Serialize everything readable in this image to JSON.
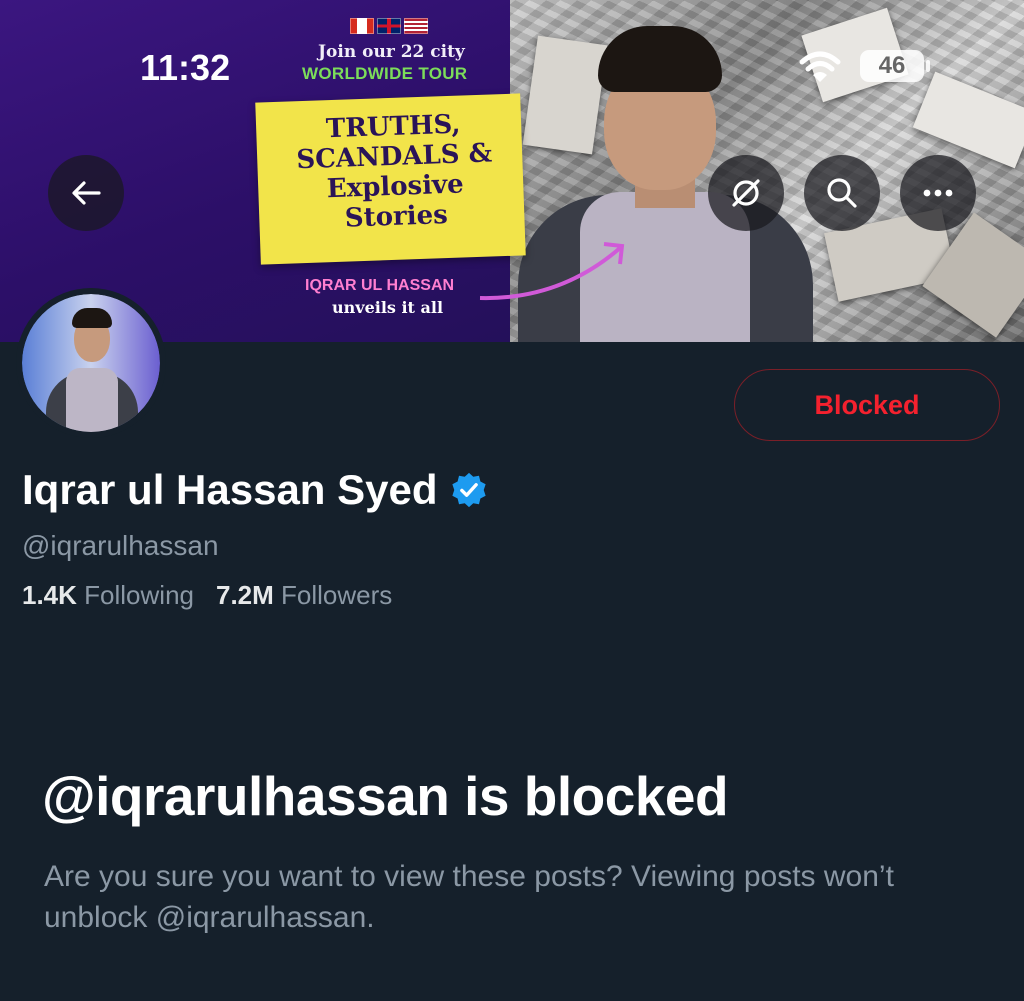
{
  "status_bar": {
    "time": "11:32",
    "battery": "46",
    "icons": [
      "wifi-icon",
      "battery-icon"
    ]
  },
  "banner": {
    "tour_line1": "Join our 22 city",
    "tour_line2": "WORLDWIDE TOUR",
    "headline": "TRUTHS, SCANDALS & Explosive Stories",
    "name_tag": "IQRAR UL HASSAN",
    "tagline": "unveils it all"
  },
  "header": {
    "buttons": [
      "back-arrow-icon",
      "grok-icon",
      "search-icon",
      "more-icon"
    ]
  },
  "profile": {
    "display_name": "Iqrar ul Hassan Syed",
    "handle": "@iqrarulhassan",
    "verified": true,
    "following_count": "1.4K",
    "following_label": "Following",
    "followers_count": "7.2M",
    "followers_label": "Followers",
    "action_label": "Blocked"
  },
  "blocked_notice": {
    "title": "@iqrarulhassan is blocked",
    "description": "Are you sure you want to view these posts? Viewing posts won’t unblock @iqrarulhassan."
  },
  "colors": {
    "background": "#15202b",
    "text_primary": "#e7e9ea",
    "text_secondary": "#8b98a5",
    "blocked_red": "#f4212e",
    "verified_blue": "#1d9bf0"
  }
}
